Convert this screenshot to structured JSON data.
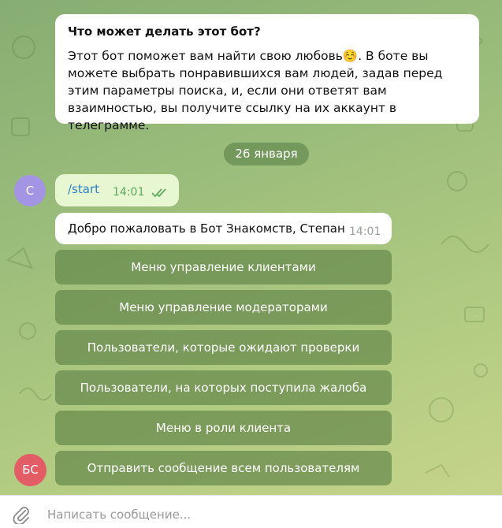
{
  "intro": {
    "title": "Что может делать этот бот?",
    "text": "Этот бот поможет вам найти свою любовь☺️. В боте вы можете выбрать понравившихся вам людей, задав перед этим параметры поиска, и, если они ответят вам взаимностью, вы получите ссылку на их аккаунт в телеграмме."
  },
  "date_separator": "26 января",
  "avatars": {
    "user": "С",
    "bot": "БС"
  },
  "outgoing": {
    "text": "/start",
    "time": "14:01",
    "status_icon": "double-check-icon"
  },
  "incoming": {
    "text": "Добро пожаловать в Бот Знакомств, Степан",
    "time": "14:01"
  },
  "keyboard": [
    "Меню управление клиентами",
    "Меню управление модераторами",
    "Пользователи, которые ожидают проверки",
    "Пользователи, на которых поступила жалоба",
    "Меню в роли клиента",
    "Отправить сообщение всем пользователям"
  ],
  "composer": {
    "placeholder": "Написать сообщение...",
    "attach_icon": "paperclip-icon"
  },
  "colors": {
    "user_avatar": "#a495e4",
    "bot_avatar": "#e35d67",
    "outgoing_bubble": "#e6f7d2",
    "link": "#2f7fc1",
    "check": "#5fa85e"
  }
}
